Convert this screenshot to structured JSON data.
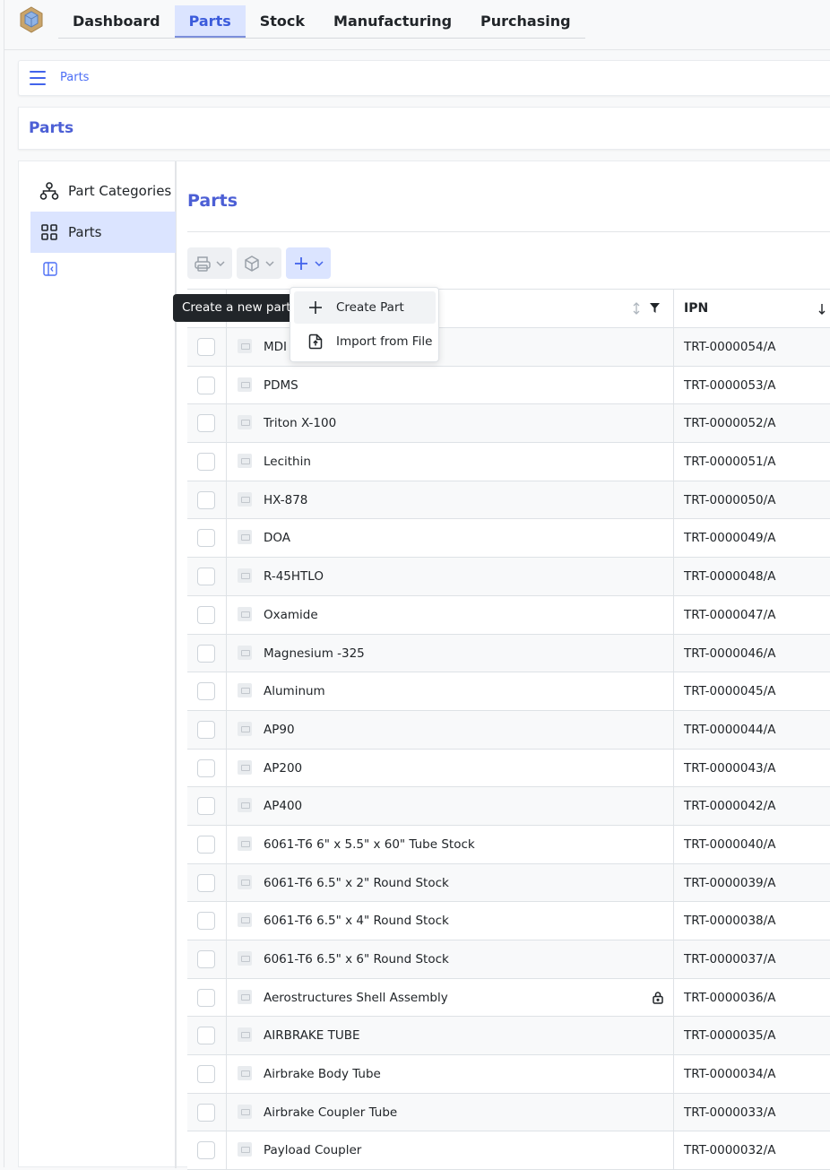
{
  "nav": {
    "tabs": [
      {
        "label": "Dashboard",
        "active": false
      },
      {
        "label": "Parts",
        "active": true
      },
      {
        "label": "Stock",
        "active": false
      },
      {
        "label": "Manufacturing",
        "active": false
      },
      {
        "label": "Purchasing",
        "active": false
      }
    ]
  },
  "breadcrumb": {
    "items": [
      "Parts"
    ]
  },
  "page": {
    "title": "Parts"
  },
  "sidebar": {
    "items": [
      {
        "label": "Part Categories",
        "icon": "sitemap-icon",
        "active": false
      },
      {
        "label": "Parts",
        "icon": "grid-icon",
        "active": true
      }
    ]
  },
  "panel": {
    "title": "Parts"
  },
  "tooltip": {
    "text": "Create a new part"
  },
  "add_menu": {
    "items": [
      {
        "label": "Create Part",
        "icon": "plus-icon"
      },
      {
        "label": "Import from File",
        "icon": "file-upload-icon"
      }
    ]
  },
  "table": {
    "columns": {
      "ipn": "IPN"
    },
    "rows": [
      {
        "name": "MDI",
        "ipn": "TRT-0000054/A",
        "locked": false
      },
      {
        "name": "PDMS",
        "ipn": "TRT-0000053/A",
        "locked": false
      },
      {
        "name": "Triton X-100",
        "ipn": "TRT-0000052/A",
        "locked": false
      },
      {
        "name": "Lecithin",
        "ipn": "TRT-0000051/A",
        "locked": false
      },
      {
        "name": "HX-878",
        "ipn": "TRT-0000050/A",
        "locked": false
      },
      {
        "name": "DOA",
        "ipn": "TRT-0000049/A",
        "locked": false
      },
      {
        "name": "R-45HTLO",
        "ipn": "TRT-0000048/A",
        "locked": false
      },
      {
        "name": "Oxamide",
        "ipn": "TRT-0000047/A",
        "locked": false
      },
      {
        "name": "Magnesium -325",
        "ipn": "TRT-0000046/A",
        "locked": false
      },
      {
        "name": "Aluminum",
        "ipn": "TRT-0000045/A",
        "locked": false
      },
      {
        "name": "AP90",
        "ipn": "TRT-0000044/A",
        "locked": false
      },
      {
        "name": "AP200",
        "ipn": "TRT-0000043/A",
        "locked": false
      },
      {
        "name": "AP400",
        "ipn": "TRT-0000042/A",
        "locked": false
      },
      {
        "name": "6061-T6 6\" x 5.5\" x 60\" Tube Stock",
        "ipn": "TRT-0000040/A",
        "locked": false
      },
      {
        "name": "6061-T6 6.5\" x 2\" Round Stock",
        "ipn": "TRT-0000039/A",
        "locked": false
      },
      {
        "name": "6061-T6 6.5\" x 4\" Round Stock",
        "ipn": "TRT-0000038/A",
        "locked": false
      },
      {
        "name": "6061-T6 6.5\" x 6\" Round Stock",
        "ipn": "TRT-0000037/A",
        "locked": false
      },
      {
        "name": "Aerostructures Shell Assembly",
        "ipn": "TRT-0000036/A",
        "locked": true
      },
      {
        "name": "AIRBRAKE TUBE",
        "ipn": "TRT-0000035/A",
        "locked": false
      },
      {
        "name": "Airbrake Body Tube",
        "ipn": "TRT-0000034/A",
        "locked": false
      },
      {
        "name": "Airbrake Coupler Tube",
        "ipn": "TRT-0000033/A",
        "locked": false
      },
      {
        "name": "Payload Coupler",
        "ipn": "TRT-0000032/A",
        "locked": false
      }
    ]
  }
}
